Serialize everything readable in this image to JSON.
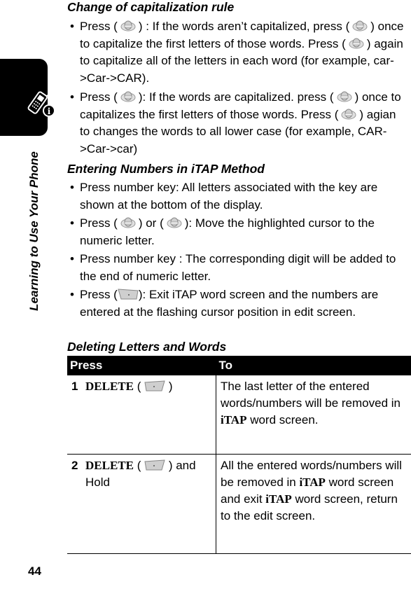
{
  "sidebar": {
    "section_title": "Learning to Use Your Phone",
    "tab_icon": "phone-info-icon"
  },
  "page_number": "44",
  "sections": {
    "capitalization": {
      "heading": "Change of capitalization rule",
      "items": [
        {
          "parts": [
            "Press (",
            ") : If the words aren’t capitalized, press (",
            ") once to capitalize the first letters of those words. Press (",
            ") again to capitalize all of the letters in each word (for example, car->Car->CAR)."
          ],
          "icon": "nav-key-up-icon"
        },
        {
          "parts": [
            "Press (",
            "): If the words are capitalized. press (",
            ") once to capitalizes the first letters of those words. Press (",
            ") agian to changes the words to all lower case (for example, CAR->Car->car)"
          ],
          "icon": "nav-key-down-icon"
        }
      ]
    },
    "numbers": {
      "heading": "Entering Numbers in iTAP Method",
      "items": [
        {
          "text": "Press number key: All letters associated with the key are shown at the bottom of the display."
        },
        {
          "parts": [
            "Press (",
            ") or (",
            "): Move the highlighted cursor to the numeric letter."
          ],
          "icons": [
            "nav-key-left-icon",
            "nav-key-right-icon"
          ]
        },
        {
          "text": "Press number key : The corresponding digit will be added to the end of numeric letter."
        },
        {
          "parts": [
            "Press (",
            "): Exit iTAP word screen and the numbers are entered at the flashing cursor position in edit screen."
          ],
          "icon": "left-soft-key-icon"
        }
      ]
    },
    "deleting": {
      "heading": "Deleting Letters and Words",
      "table": {
        "headers": [
          "Press",
          "To"
        ],
        "rows": [
          {
            "num": "1",
            "press_key": "DELETE",
            "press_open": " (",
            "press_close": " )",
            "press_suffix": "",
            "icon": "right-soft-key-icon",
            "to_parts": [
              "The last letter of the entered words/numbers will be removed in ",
              "iTAP",
              " word screen."
            ]
          },
          {
            "num": "2",
            "press_key": "DELETE",
            "press_open": " (",
            "press_close": " ) and",
            "press_suffix": "Hold",
            "icon": "right-soft-key-icon",
            "to_parts": [
              "All the entered words/numbers will be removed in ",
              "iTAP",
              " word screen and exit ",
              "iTAP",
              " word screen, return to the edit screen."
            ]
          }
        ]
      }
    }
  }
}
